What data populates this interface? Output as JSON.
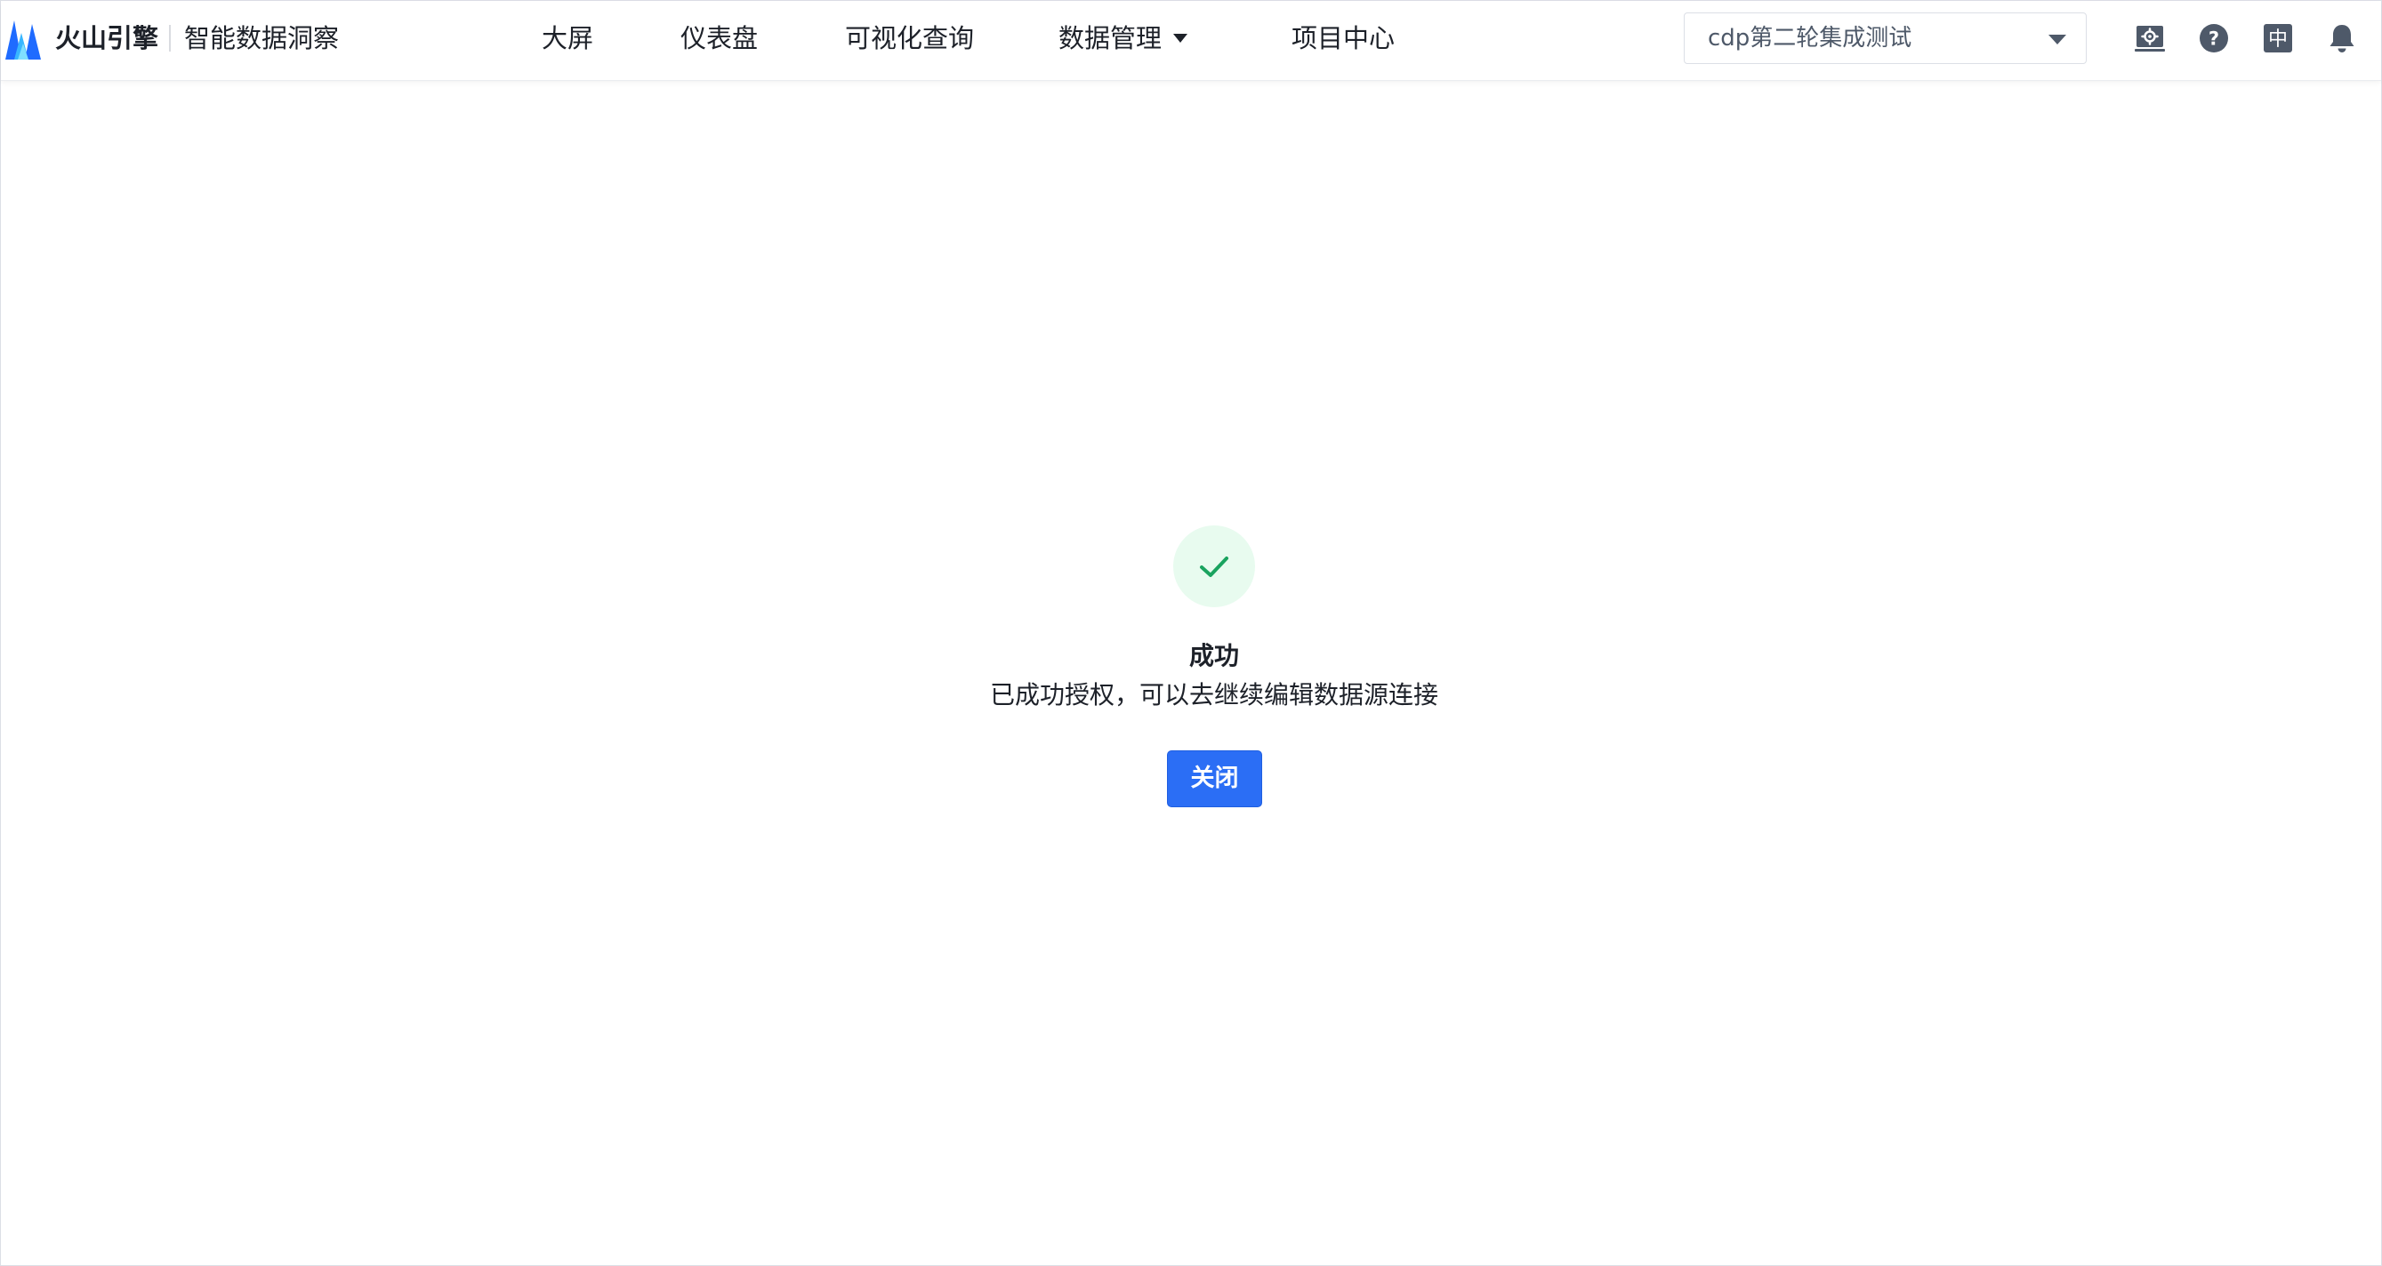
{
  "header": {
    "brand": "火山引擎",
    "product": "智能数据洞察",
    "nav": {
      "big_screen": "大屏",
      "dashboard": "仪表盘",
      "visual_query": "可视化查询",
      "data_management": "数据管理",
      "project_center": "项目中心"
    },
    "project_select": {
      "value": "cdp第二轮集成测试"
    },
    "icons": [
      "admin-settings-icon",
      "help-icon",
      "language-zh-icon",
      "notification-bell-icon"
    ],
    "language_glyph": "中"
  },
  "result": {
    "status": "success",
    "title": "成功",
    "subtitle": "已成功授权，可以去继续编辑数据源连接",
    "close_label": "关闭"
  },
  "colors": {
    "primary": "#2b6ef5",
    "success": "#1aa35f",
    "success_bg": "#e8fbef",
    "text": "#1d2129",
    "icon": "#4e5969"
  }
}
